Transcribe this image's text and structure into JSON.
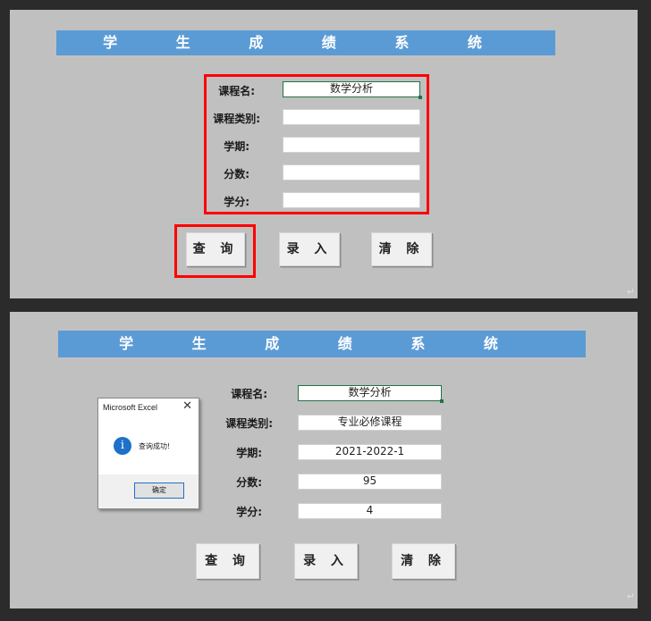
{
  "title": "学 生 成 绩 系 统",
  "paragraph_mark": "↵",
  "labels": {
    "course_name": "课程名:",
    "course_type": "课程类别:",
    "term": "学期:",
    "score": "分数:",
    "credit": "学分:"
  },
  "buttons": {
    "query": "查 询",
    "enter": "录 入",
    "clear": "清 除"
  },
  "top_form": {
    "course_name": "数学分析",
    "course_type": "",
    "term": "",
    "score": "",
    "credit": ""
  },
  "bottom_form": {
    "course_name": "数学分析",
    "course_type": "专业必修课程",
    "term": "2021-2022-1",
    "score": "95",
    "credit": "4"
  },
  "dialog": {
    "title": "Microsoft Excel",
    "close_glyph": "✕",
    "icon": "info-icon",
    "message": "查询成功!",
    "ok_label": "确定"
  },
  "colors": {
    "title_bar": "#5b9bd5",
    "panel_bg": "#c0c0c0",
    "highlight": "#ff0000",
    "active_cell_border": "#217346"
  }
}
